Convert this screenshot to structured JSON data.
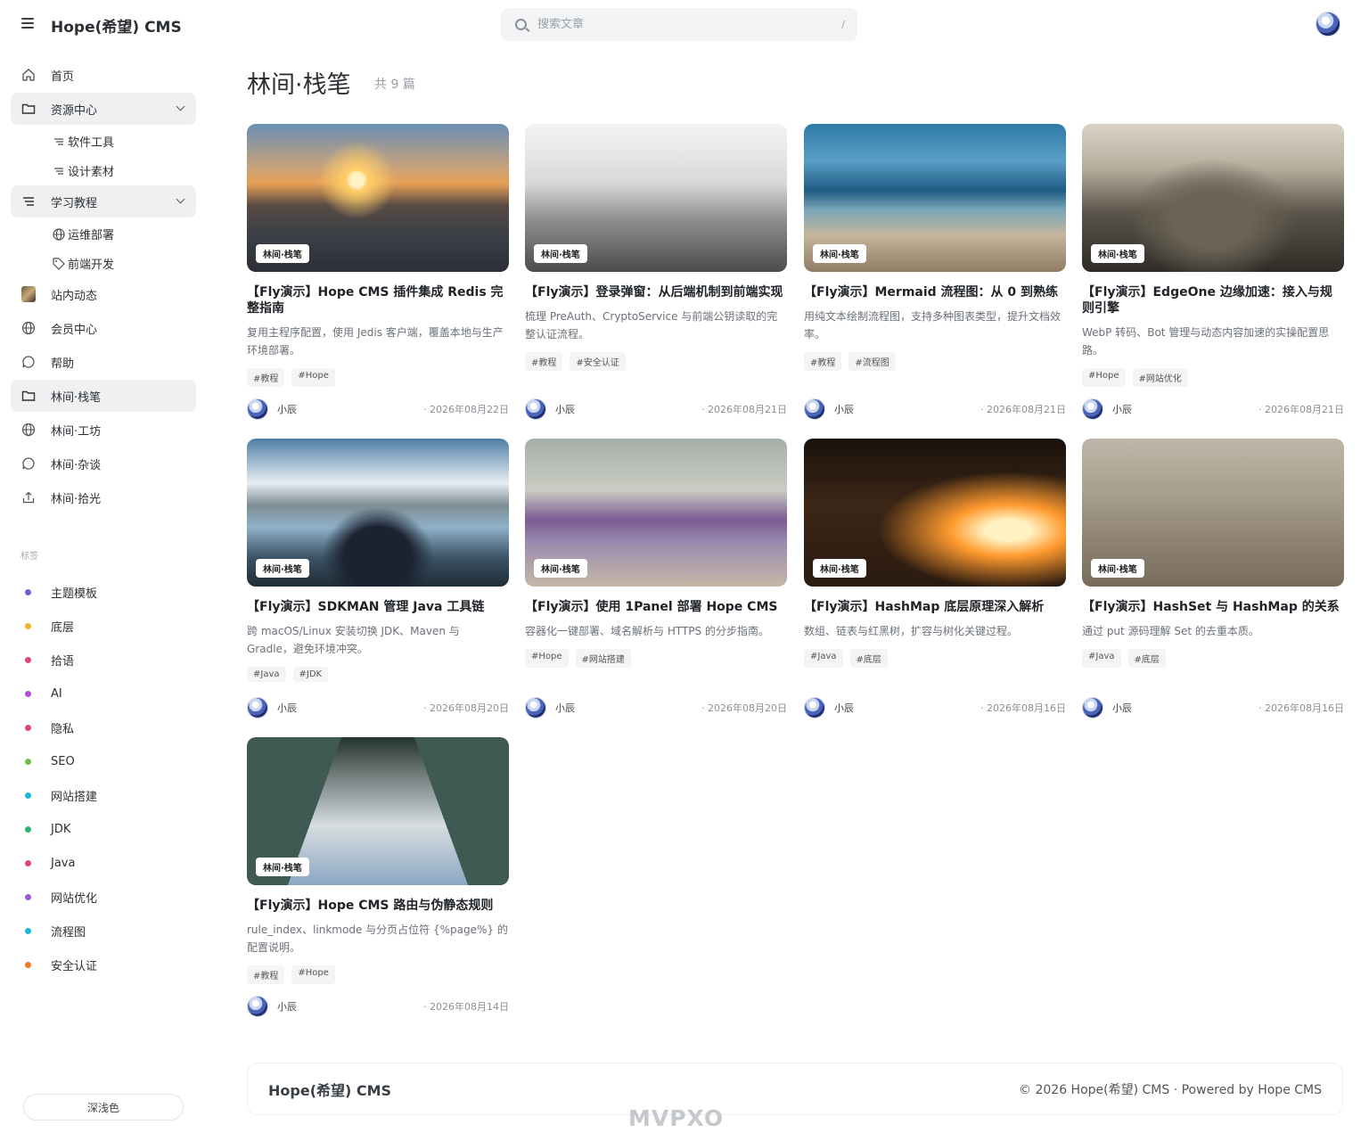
{
  "header": {
    "brand": "Hope(希望) CMS",
    "search_placeholder": "搜索文章",
    "search_shortcut": "/"
  },
  "sidebar": {
    "items": [
      {
        "label": "首页",
        "icon": "home-icon"
      },
      {
        "label": "资源中心",
        "icon": "folder-icon",
        "children": [
          {
            "label": "软件工具",
            "icon": "list-icon"
          },
          {
            "label": "设计素材",
            "icon": "list-icon"
          }
        ]
      },
      {
        "label": "学习教程",
        "icon": "list-icon",
        "children": [
          {
            "label": "运维部署",
            "icon": "globe-icon"
          },
          {
            "label": "前端开发",
            "icon": "tag-icon"
          }
        ]
      },
      {
        "label": "站内动态",
        "icon": "image-thumb-icon"
      },
      {
        "label": "会员中心",
        "icon": "globe-icon"
      },
      {
        "label": "帮助",
        "icon": "chat-icon"
      },
      {
        "label": "林间·栈笔",
        "icon": "folder-icon"
      },
      {
        "label": "林间·工坊",
        "icon": "globe-icon"
      },
      {
        "label": "林间·杂谈",
        "icon": "chat-icon"
      },
      {
        "label": "林间·拾光",
        "icon": "upload-icon"
      }
    ],
    "tags_title": "标签",
    "tags": [
      {
        "label": "主题模板",
        "color": "#7c5cd6"
      },
      {
        "label": "底层",
        "color": "#f0b429"
      },
      {
        "label": "拾语",
        "color": "#e0457b"
      },
      {
        "label": "AI",
        "color": "#b44fd6"
      },
      {
        "label": "隐私",
        "color": "#e0457b"
      },
      {
        "label": "SEO",
        "color": "#6cc04a"
      },
      {
        "label": "网站搭建",
        "color": "#1fb8d6"
      },
      {
        "label": "JDK",
        "color": "#2bb673"
      },
      {
        "label": "Java",
        "color": "#e0457b"
      },
      {
        "label": "网站优化",
        "color": "#9b59d6"
      },
      {
        "label": "流程图",
        "color": "#1fb8d6"
      },
      {
        "label": "安全认证",
        "color": "#f07a29"
      }
    ],
    "theme_button": "深浅色"
  },
  "main": {
    "title": "林间·栈笔",
    "count": "共 9 篇",
    "articles": [
      {
        "badge": "林间·栈笔",
        "title": "【Fly演示】Hope CMS 插件集成 Redis 完整指南",
        "desc": "复用主程序配置，使用 Jedis 客户端，覆盖本地与生产环境部署。",
        "tags": [
          "#教程",
          "#Hope"
        ],
        "author": "小辰",
        "date": "· 2026年08月22日"
      },
      {
        "badge": "林间·栈笔",
        "title": "【Fly演示】登录弹窗：从后端机制到前端实现",
        "desc": "梳理 PreAuth、CryptoService 与前端公钥读取的完整认证流程。",
        "tags": [
          "#教程",
          "#安全认证"
        ],
        "author": "小辰",
        "date": "· 2026年08月21日"
      },
      {
        "badge": "林间·栈笔",
        "title": "【Fly演示】Mermaid 流程图：从 0 到熟练",
        "desc": "用纯文本绘制流程图，支持多种图表类型，提升文档效率。",
        "tags": [
          "#教程",
          "#流程图"
        ],
        "author": "小辰",
        "date": "· 2026年08月21日"
      },
      {
        "badge": "林间·栈笔",
        "title": "【Fly演示】EdgeOne 边缘加速：接入与规则引擎",
        "desc": "WebP 转码、Bot 管理与动态内容加速的实操配置思路。",
        "tags": [
          "#Hope",
          "#网站优化"
        ],
        "author": "小辰",
        "date": "· 2026年08月21日"
      },
      {
        "badge": "林间·栈笔",
        "title": "【Fly演示】SDKMAN 管理 Java 工具链",
        "desc": "跨 macOS/Linux 安装切换 JDK、Maven 与 Gradle，避免环境冲突。",
        "tags": [
          "#Java",
          "#JDK"
        ],
        "author": "小辰",
        "date": "· 2026年08月20日"
      },
      {
        "badge": "林间·栈笔",
        "title": "【Fly演示】使用 1Panel 部署 Hope CMS",
        "desc": "容器化一键部署、域名解析与 HTTPS 的分步指南。",
        "tags": [
          "#Hope",
          "#网站搭建"
        ],
        "author": "小辰",
        "date": "· 2026年08月20日"
      },
      {
        "badge": "林间·栈笔",
        "title": "【Fly演示】HashMap 底层原理深入解析",
        "desc": "数组、链表与红黑树，扩容与树化关键过程。",
        "tags": [
          "#Java",
          "#底层"
        ],
        "author": "小辰",
        "date": "· 2026年08月16日"
      },
      {
        "badge": "林间·栈笔",
        "title": "【Fly演示】HashSet 与 HashMap 的关系",
        "desc": "通过 put 源码理解 Set 的去重本质。",
        "tags": [
          "#Java",
          "#底层"
        ],
        "author": "小辰",
        "date": "· 2026年08月16日"
      },
      {
        "badge": "林间·栈笔",
        "title": "【Fly演示】Hope CMS 路由与伪静态规则",
        "desc": "rule_index、linkmode 与分页占位符 {%page%} 的配置说明。",
        "tags": [
          "#教程",
          "#Hope"
        ],
        "author": "小辰",
        "date": "· 2026年08月14日"
      }
    ]
  },
  "footer": {
    "brand": "Hope(希望) CMS",
    "copyright": "© 2026 Hope(希望) CMS · Powered by Hope CMS"
  },
  "watermark": "MVPXO"
}
